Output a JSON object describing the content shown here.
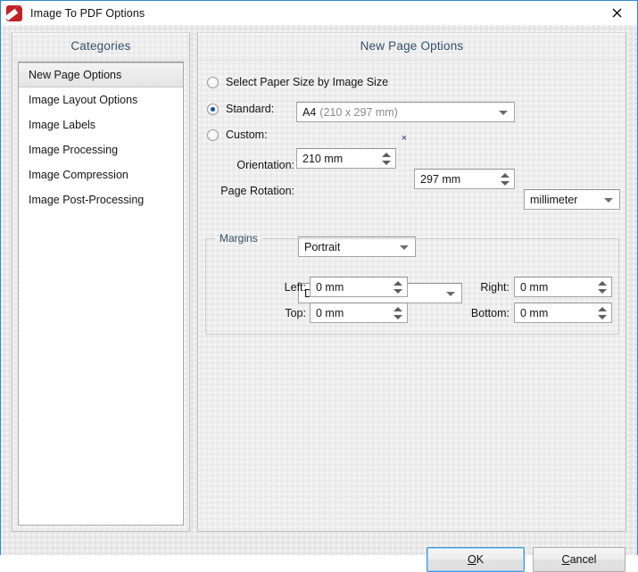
{
  "window": {
    "title": "Image To PDF Options",
    "icon": "app-icon",
    "close_label": "close-icon"
  },
  "sidebar": {
    "heading": "Categories",
    "items": [
      {
        "label": "New Page Options",
        "selected": true
      },
      {
        "label": "Image Layout Options",
        "selected": false
      },
      {
        "label": "Image Labels",
        "selected": false
      },
      {
        "label": "Image Processing",
        "selected": false
      },
      {
        "label": "Image Compression",
        "selected": false
      },
      {
        "label": "Image Post-Processing",
        "selected": false
      }
    ]
  },
  "main": {
    "heading": "New Page Options",
    "paper_size": {
      "by_image_size": {
        "label": "Select Paper Size by Image Size",
        "checked": false
      },
      "standard": {
        "label": "Standard:",
        "checked": true,
        "value_name": "A4",
        "value_dims": "(210 x 297 mm)"
      },
      "custom": {
        "label": "Custom:",
        "checked": false,
        "width": "210 mm",
        "separator": "×",
        "height": "297 mm",
        "unit": "millimeter"
      }
    },
    "orientation": {
      "label": "Orientation:",
      "value": "Portrait"
    },
    "page_rotation": {
      "label": "Page Rotation:",
      "value": "Do not rotate"
    },
    "margins": {
      "legend": "Margins",
      "left": {
        "label": "Left:",
        "value": "0 mm"
      },
      "right": {
        "label": "Right:",
        "value": "0 mm"
      },
      "top": {
        "label": "Top:",
        "value": "0 mm"
      },
      "bottom": {
        "label": "Bottom:",
        "value": "0 mm"
      }
    }
  },
  "footer": {
    "ok": {
      "accel": "O",
      "rest": "K"
    },
    "cancel": {
      "accel": "C",
      "rest": "ancel"
    }
  },
  "colors": {
    "window_border": "#2d8ad6",
    "heading_text": "#33506b",
    "radio_dot": "#1b4fa0",
    "icon_red": "#c22127",
    "focus_ring": "#3c97dd"
  }
}
